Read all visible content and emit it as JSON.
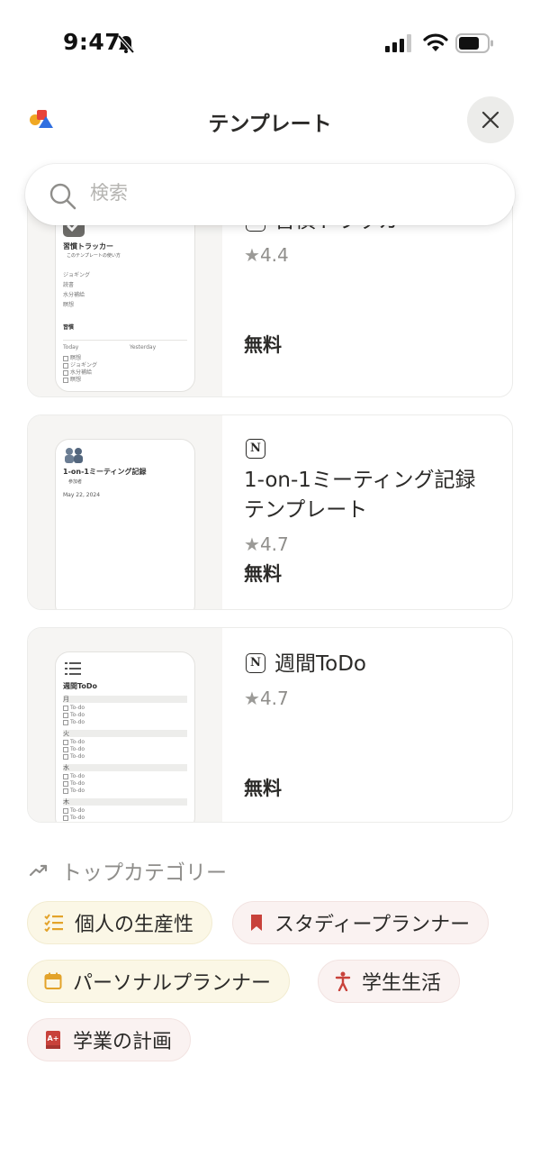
{
  "status_bar": {
    "time": "9:47"
  },
  "header": {
    "title": "テンプレート"
  },
  "search": {
    "placeholder": "検索"
  },
  "templates": [
    {
      "title": "習慣トラッカー",
      "rating": "4.4",
      "price": "無料",
      "preview": {
        "heading": "習慣トラッカー",
        "sub": "このテンプレートの使い方",
        "items": [
          "ジョギング",
          "読書",
          "水分補給",
          "瞑想"
        ],
        "db_title": "習慣",
        "col1": "Today",
        "col2": "Yesterday",
        "rows": [
          "瞑想",
          "ジョギング",
          "水分補給",
          "瞑想"
        ]
      }
    },
    {
      "title": "1-on-1ミーティング記録テンプレート",
      "rating": "4.7",
      "price": "無料",
      "preview": {
        "heading": "1-on-1ミーティング記録",
        "sub": "参加者",
        "date": "May 22, 2024"
      }
    },
    {
      "title": "週間ToDo",
      "rating": "4.7",
      "price": "無料",
      "preview": {
        "heading": "週間ToDo",
        "days": [
          "月",
          "火",
          "水",
          "木"
        ],
        "todo": "To-do"
      }
    }
  ],
  "categories": {
    "heading": "トップカテゴリー",
    "items": [
      {
        "label": "個人の生産性",
        "icon": "checklist-icon",
        "color": "#e3a32a"
      },
      {
        "label": "スタディープランナー",
        "icon": "bookmark-icon",
        "color": "#c8423b"
      },
      {
        "label": "パーソナルプランナー",
        "icon": "calendar-icon",
        "color": "#e3a32a"
      },
      {
        "label": "学生生活",
        "icon": "person-icon",
        "color": "#c8423b"
      },
      {
        "label": "学業の計画",
        "icon": "grade-book-icon",
        "color": "#c8423b"
      }
    ]
  }
}
